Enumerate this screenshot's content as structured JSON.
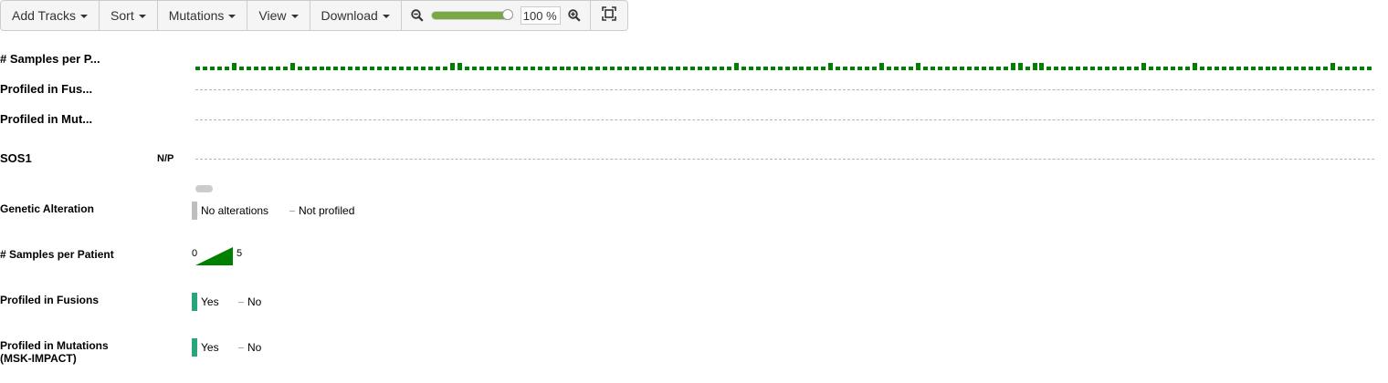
{
  "toolbar": {
    "add_tracks": "Add Tracks",
    "sort": "Sort",
    "mutations": "Mutations",
    "view": "View",
    "download": "Download",
    "zoom_value": "100 %",
    "zoom_level": 0.95,
    "zoom_out_icon": "zoom-out-icon",
    "zoom_in_icon": "zoom-in-icon",
    "fit_icon": "fit-to-screen-icon"
  },
  "tracks": {
    "samples": "# Samples per P...",
    "fusions": "Profiled in Fus...",
    "mutations": "Profiled in Mut...",
    "gene": "SOS1",
    "gene_status": "N/P"
  },
  "samples_track": {
    "color": "#008000",
    "tall_indices": [
      5,
      13,
      35,
      36,
      74,
      87,
      94,
      99,
      112,
      113,
      115,
      116,
      130,
      137,
      156
    ]
  },
  "legends": {
    "genetic_alteration": {
      "title": "Genetic Alteration",
      "no_alterations": "No alterations",
      "not_profiled": "Not profiled",
      "no_alterations_color": "#bebebe"
    },
    "samples_per_patient": {
      "title": "# Samples per Patient",
      "min": "0",
      "max": "5",
      "color": "#008000"
    },
    "profiled_fusions": {
      "title": "Profiled in Fusions",
      "yes": "Yes",
      "no": "No",
      "yes_color": "#2aa57a"
    },
    "profiled_mutations": {
      "title": "Profiled in Mutations (MSK-IMPACT)",
      "title_line1": "Profiled in Mutations",
      "title_line2": "(MSK-IMPACT)",
      "yes": "Yes",
      "no": "No",
      "yes_color": "#2aa57a"
    }
  }
}
